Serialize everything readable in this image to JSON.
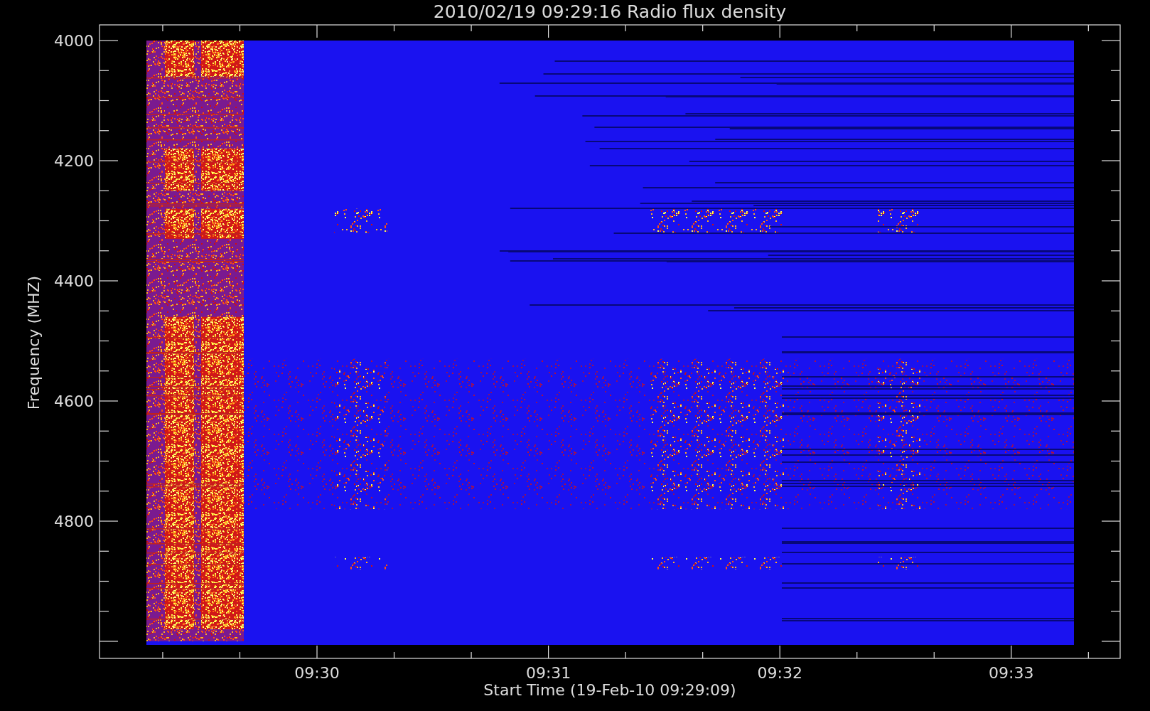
{
  "plot": {
    "title": "2010/02/19 09:29:16 Radio flux density",
    "ylabel": "Frequency (MHZ)",
    "xlabel": "Start Time (19-Feb-10 09:29:09)",
    "y_tick_labels": [
      "4000",
      "4200",
      "4400",
      "4600",
      "4800"
    ],
    "x_tick_labels": [
      "09:30",
      "09:31",
      "09:32",
      "09:33"
    ]
  }
}
